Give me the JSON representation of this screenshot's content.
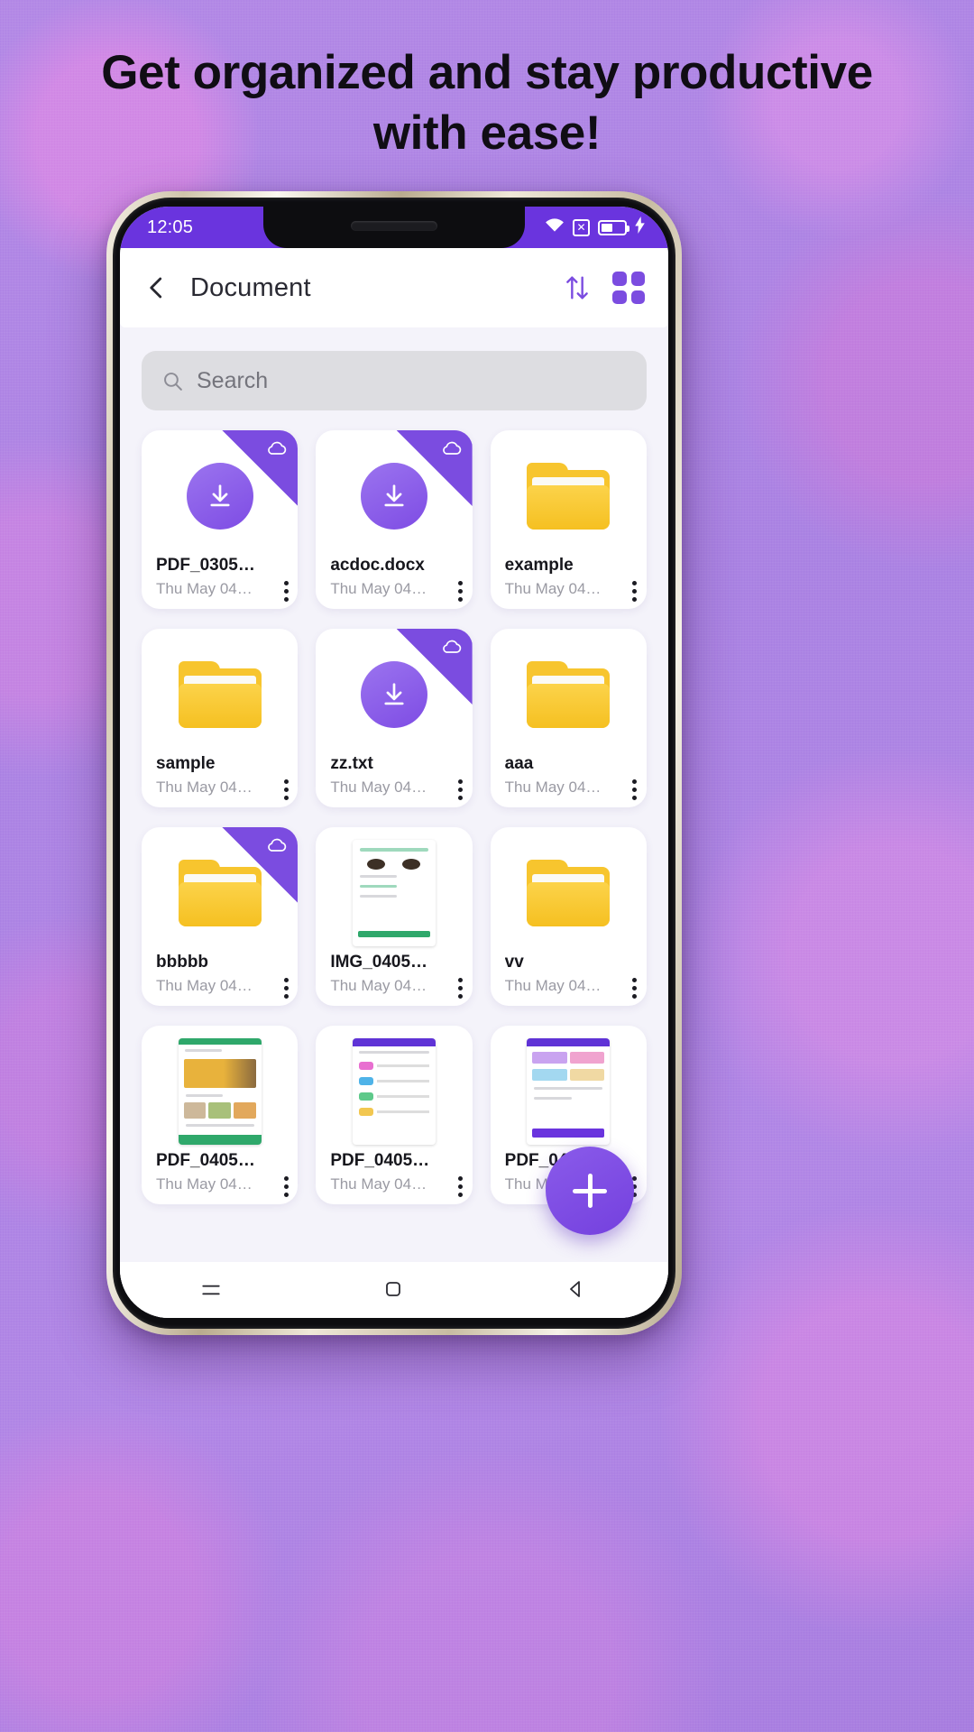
{
  "headline": "Get organized and stay productive with ease!",
  "status_bar": {
    "time": "12:05",
    "icons": [
      "wifi-icon",
      "no-sim-icon",
      "battery-icon",
      "charging-bolt-icon"
    ],
    "background": "#6a34de"
  },
  "appbar": {
    "back_icon": "chevron-left-icon",
    "title": "Document",
    "sort_icon": "sort-arrows-icon",
    "grid_icon": "grid-view-icon",
    "accent": "#7b4ce0"
  },
  "search": {
    "placeholder": "Search",
    "icon": "search-icon",
    "value": ""
  },
  "files": [
    {
      "name": "PDF_0305…",
      "date": "Thu May 04…",
      "type": "download",
      "cloud": true
    },
    {
      "name": "acdoc.docx",
      "date": "Thu May 04…",
      "type": "download",
      "cloud": true
    },
    {
      "name": "example",
      "date": "Thu May 04…",
      "type": "folder",
      "cloud": false
    },
    {
      "name": "sample",
      "date": "Thu May 04…",
      "type": "folder",
      "cloud": false
    },
    {
      "name": "zz.txt",
      "date": "Thu May 04…",
      "type": "download",
      "cloud": true
    },
    {
      "name": "aaa",
      "date": "Thu May 04…",
      "type": "folder",
      "cloud": false
    },
    {
      "name": "bbbbb",
      "date": "Thu May 04…",
      "type": "folder",
      "cloud": true
    },
    {
      "name": "IMG_0405…",
      "date": "Thu May 04…",
      "type": "image-green",
      "cloud": false
    },
    {
      "name": "vv",
      "date": "Thu May 04…",
      "type": "folder",
      "cloud": false
    },
    {
      "name": "PDF_0405…",
      "date": "Thu May 04…",
      "type": "image-food",
      "cloud": false
    },
    {
      "name": "PDF_0405…",
      "date": "Thu May 04…",
      "type": "image-list",
      "cloud": false
    },
    {
      "name": "PDF_0405…",
      "date": "Thu May 04…",
      "type": "image-app",
      "cloud": false
    }
  ],
  "fab": {
    "label": "+",
    "name": "add-button",
    "color": "#7b4ce0"
  },
  "nav_bar": {
    "recents": "menu-icon",
    "home": "home-square-icon",
    "back": "back-triangle-icon"
  }
}
